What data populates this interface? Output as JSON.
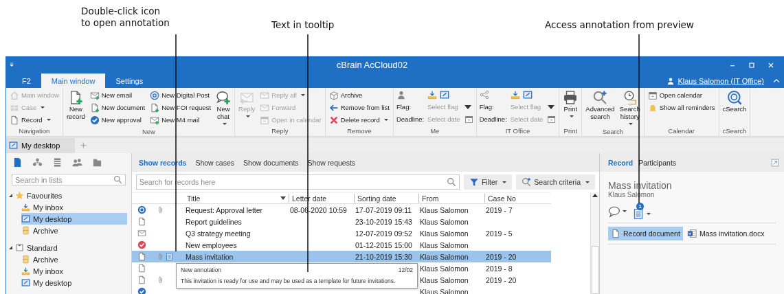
{
  "callouts": [
    {
      "lines": [
        "Double-click icon",
        "to open annotation"
      ]
    },
    {
      "lines": [
        "Text in tooltip"
      ]
    },
    {
      "lines": [
        "Access annotation from preview"
      ]
    }
  ],
  "window": {
    "title": "cBrain AcCloud02",
    "user": "Klaus Salomon (IT Office)"
  },
  "tabs": [
    {
      "label": "F2",
      "selected": false
    },
    {
      "label": "Main window",
      "selected": true
    },
    {
      "label": "Settings",
      "selected": false
    }
  ],
  "ribbon": [
    {
      "label": "Navigation",
      "items": [
        {
          "kind": "small",
          "label": "Main window",
          "disabled": true,
          "dropdown": false
        },
        {
          "kind": "small",
          "label": "Case",
          "disabled": true,
          "dropdown": true
        },
        {
          "kind": "small",
          "label": "Record",
          "disabled": false,
          "dropdown": true
        }
      ]
    },
    {
      "label": "New",
      "items": [
        {
          "kind": "large",
          "label": "New record",
          "disabled": false,
          "dropdown": false
        },
        {
          "kind": "small",
          "label": "New email",
          "disabled": false,
          "dropdown": false
        },
        {
          "kind": "small",
          "label": "New document",
          "disabled": false,
          "dropdown": false
        },
        {
          "kind": "small",
          "label": "New approval",
          "disabled": false,
          "dropdown": false
        },
        {
          "kind": "small",
          "label": "New Digital Post",
          "disabled": false,
          "dropdown": false
        },
        {
          "kind": "small",
          "label": "New FOI request",
          "disabled": false,
          "dropdown": false
        },
        {
          "kind": "small",
          "label": "New M4 mail",
          "disabled": false,
          "dropdown": false
        },
        {
          "kind": "large",
          "label": "New chat",
          "disabled": false,
          "dropdown": true
        }
      ]
    },
    {
      "label": "Reply",
      "items": [
        {
          "kind": "large",
          "label": "Reply",
          "disabled": true,
          "dropdown": true
        },
        {
          "kind": "small",
          "label": "Reply all",
          "disabled": true,
          "dropdown": true
        },
        {
          "kind": "small",
          "label": "Forward",
          "disabled": true,
          "dropdown": false
        },
        {
          "kind": "small",
          "label": "Open in calendar",
          "disabled": true,
          "dropdown": false
        }
      ]
    },
    {
      "label": "Remove",
      "items": [
        {
          "kind": "small",
          "label": "Archive",
          "disabled": false,
          "dropdown": false
        },
        {
          "kind": "small",
          "label": "Remove from list",
          "disabled": false,
          "dropdown": false
        },
        {
          "kind": "small",
          "label": "Delete record",
          "disabled": false,
          "dropdown": true
        }
      ]
    },
    {
      "label": "Me",
      "items": [
        {
          "kind": "flag",
          "flag": {
            "label": "Flag:",
            "placeholder": "Select flag"
          },
          "deadline": {
            "label": "Deadline:",
            "placeholder": "Select date"
          }
        }
      ]
    },
    {
      "label": "IT Office",
      "items": [
        {
          "kind": "flag",
          "flag": {
            "label": "Flag:",
            "placeholder": "Select flag"
          },
          "deadline": {
            "label": "Deadline:",
            "placeholder": "Select date"
          }
        }
      ]
    },
    {
      "label": "Print",
      "items": [
        {
          "kind": "large",
          "label": "Print",
          "disabled": false,
          "dropdown": true
        }
      ]
    },
    {
      "label": "Search",
      "items": [
        {
          "kind": "large",
          "label": "Advanced search",
          "disabled": false,
          "dropdown": false
        },
        {
          "kind": "large",
          "label": "Search history",
          "disabled": false,
          "dropdown": true
        }
      ]
    },
    {
      "label": "Calendar",
      "items": [
        {
          "kind": "small",
          "label": "Open calendar",
          "disabled": false,
          "dropdown": false
        },
        {
          "kind": "small",
          "label": "Show all reminders",
          "disabled": false,
          "dropdown": false
        }
      ]
    },
    {
      "label": "cSearch",
      "items": [
        {
          "kind": "large",
          "label": "cSearch",
          "disabled": false,
          "dropdown": false
        }
      ]
    }
  ],
  "workspace_tabs": [
    {
      "label": "My desktop",
      "selected": true
    }
  ],
  "sidebar": {
    "view_icons": [
      {
        "kind": "document",
        "selected": true
      },
      {
        "kind": "organisation",
        "selected": false
      },
      {
        "kind": "list",
        "selected": false
      },
      {
        "kind": "people",
        "selected": false
      },
      {
        "kind": "folder",
        "selected": false
      }
    ],
    "search": {
      "placeholder": "Search in lists"
    },
    "tree": [
      {
        "kind": "favourites",
        "label": "Favourites",
        "expanded": true,
        "selected": false,
        "children": [
          {
            "kind": "inbox",
            "label": "My inbox",
            "selected": false
          },
          {
            "kind": "desktop",
            "label": "My desktop",
            "selected": true
          },
          {
            "kind": "archive",
            "label": "Archive",
            "selected": false
          }
        ]
      },
      {
        "kind": "standard",
        "label": "Standard",
        "expanded": true,
        "selected": false,
        "children": [
          {
            "kind": "archive",
            "label": "Archive",
            "selected": false
          },
          {
            "kind": "inbox",
            "label": "My inbox",
            "selected": false
          },
          {
            "kind": "desktop",
            "label": "My desktop",
            "selected": false
          }
        ]
      }
    ]
  },
  "records": {
    "views": [
      {
        "label": "Show records",
        "selected": true
      },
      {
        "label": "Show cases",
        "selected": false
      },
      {
        "label": "Show documents",
        "selected": false
      },
      {
        "label": "Show requests",
        "selected": false
      }
    ],
    "search": {
      "placeholder": "Search for records here"
    },
    "filter": "Filter",
    "search_criteria": "Search criteria",
    "columns": [
      {
        "label": "Title",
        "dropdown": true
      },
      {
        "label": "Letter date",
        "dropdown": false
      },
      {
        "label": "Sorting date",
        "dropdown": false
      },
      {
        "label": "From",
        "dropdown": false
      },
      {
        "label": "Case No",
        "dropdown": false
      }
    ],
    "rows": [
      {
        "kind": "approval",
        "attachment": true,
        "annotation": false,
        "selected": false,
        "title": "Request: Approval letter",
        "letter_date": "08-06-2020 10:59",
        "sorting_date": "17-07-2019 09:11",
        "from": "Klaus Salomon",
        "case_no": "2019 - 7"
      },
      {
        "kind": "document",
        "attachment": false,
        "annotation": false,
        "selected": false,
        "title": "Report guidelines",
        "sorting_date": "23-10-2019 15:43",
        "from": "Klaus Salomon"
      },
      {
        "kind": "email",
        "attachment": false,
        "annotation": false,
        "selected": false,
        "title": "Q3 strategy meeting",
        "sorting_date": "12-07-2019 09:52",
        "from": "Klaus Salomon",
        "case_no": "2019 - 5"
      },
      {
        "kind": "check",
        "color": "#e0475b",
        "attachment": false,
        "annotation": false,
        "selected": false,
        "title": "New employees",
        "sorting_date": "01-12-2015 15:00",
        "from": "Klaus Salomon"
      },
      {
        "kind": "document",
        "attachment": true,
        "annotation": true,
        "selected": true,
        "title": "Mass invitation",
        "sorting_date": "21-10-2019 15:30",
        "from": "Klaus Salomon",
        "case_no": "2019 - 20"
      },
      {
        "kind": "document",
        "attachment": false,
        "annotation": false,
        "selected": false,
        "from": "Klaus Salomon",
        "case_no": "2019 - 8"
      },
      {
        "kind": "document",
        "attachment": true,
        "annotation": false,
        "selected": false,
        "from": "Klaus Salomon",
        "case_no": "2019 - 20"
      },
      {
        "kind": "check",
        "color": "#2b6fc0",
        "attachment": false,
        "annotation": false,
        "selected": false,
        "from": "Klaus Salomon"
      }
    ],
    "tooltip": {
      "title": "New annotation",
      "date": "12/02",
      "text": "This invitation is ready for use and may be used as a template for future invitations."
    }
  },
  "preview": {
    "tabs": [
      {
        "label": "Record",
        "selected": true
      },
      {
        "label": "Participants",
        "selected": false
      }
    ],
    "title": "Mass invitation",
    "author": "Klaus Salomon",
    "annotation_count": "1",
    "document_tabs": [
      {
        "kind": "record",
        "label": "Record document",
        "selected": true
      },
      {
        "kind": "word",
        "label": "Mass invitation.docx",
        "selected": false
      }
    ]
  }
}
